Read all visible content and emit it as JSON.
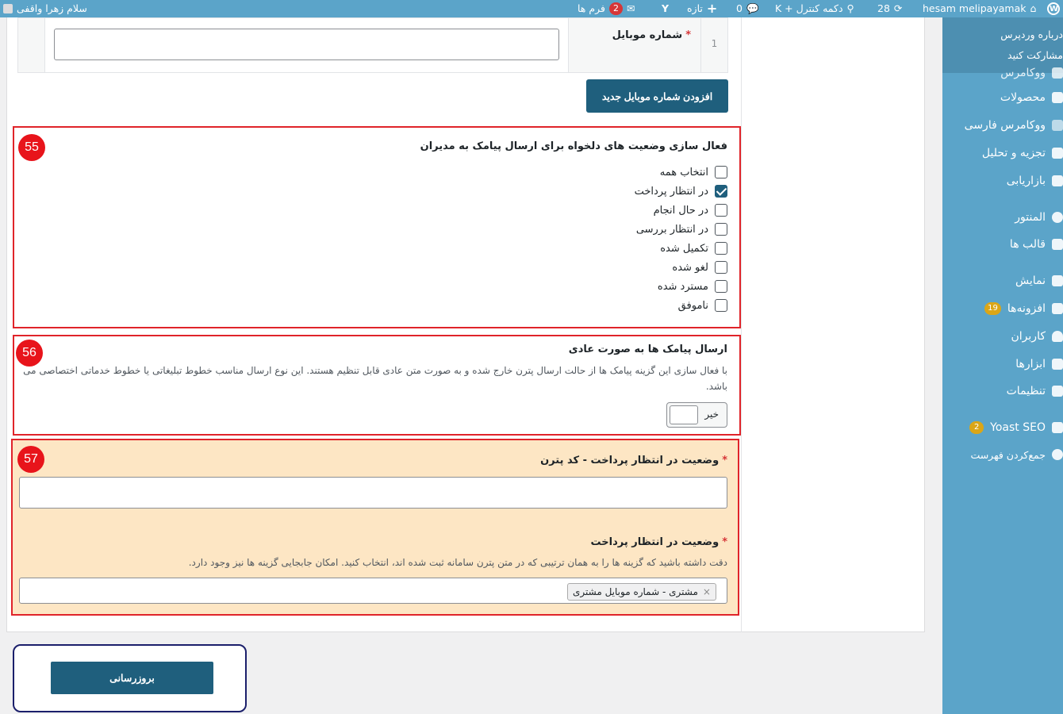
{
  "adminbar": {
    "greeting": "سلام زهرا واقفی",
    "forms_label": "فرم ها",
    "forms_count": "2",
    "new_label": "تازه",
    "comments_count": "0",
    "control_label": "K + دکمه کنترل",
    "updates_count": "28",
    "site_name": "hesam melipayamak"
  },
  "sidebar": {
    "flyout": [
      "درباره وردپرس",
      "مشارکت کنید"
    ],
    "partial_item": "ووکامرس",
    "items": [
      {
        "label": "محصولات",
        "badge": ""
      },
      {
        "label": "ووکامرس فارسی",
        "badge": ""
      },
      {
        "label": "تجزیه و تحلیل",
        "badge": ""
      },
      {
        "label": "بازاریابی",
        "badge": ""
      },
      {
        "label": "المنتور",
        "badge": ""
      },
      {
        "label": "قالب ها",
        "badge": ""
      },
      {
        "label": "نمایش",
        "badge": ""
      },
      {
        "label": "افزونه‌ها",
        "badge": "19"
      },
      {
        "label": "کاربران",
        "badge": ""
      },
      {
        "label": "ابزارها",
        "badge": ""
      },
      {
        "label": "تنظیمات",
        "badge": ""
      },
      {
        "label": "Yoast SEO",
        "badge": "2"
      },
      {
        "label": "جمع‌کردن فهرست",
        "badge": ""
      }
    ]
  },
  "mobile_row": {
    "index": "1",
    "label": "شماره موبایل",
    "required": "*",
    "value": ""
  },
  "add_mobile_button": "افزودن شماره موبایل جدید",
  "section55": {
    "number": "55",
    "title": "فعال سازی وضعیت های دلخواه برای ارسال پیامک به مدیران",
    "options": [
      {
        "label": "انتخاب همه",
        "checked": false
      },
      {
        "label": "در انتظار پرداخت",
        "checked": true
      },
      {
        "label": "در حال انجام",
        "checked": false
      },
      {
        "label": "در انتظار بررسی",
        "checked": false
      },
      {
        "label": "تکمیل شده",
        "checked": false
      },
      {
        "label": "لغو شده",
        "checked": false
      },
      {
        "label": "مسترد شده",
        "checked": false
      },
      {
        "label": "ناموفق",
        "checked": false
      }
    ]
  },
  "section56": {
    "number": "56",
    "title": "ارسال پیامک ها به صورت عادی",
    "desc": "با فعال سازی این گزینه پیامک ها از حالت ارسال پترن خارج شده و به صورت متن عادی قابل تنظیم هستند. این نوع ارسال مناسب خطوط تبلیغاتی یا خطوط خدماتی اختصاصی می باشد.",
    "toggle_label": "خیر"
  },
  "section57": {
    "number": "57",
    "field1_label": "وضعیت در انتظار پرداخت - کد پترن",
    "field1_value": "",
    "field2_label": "وضعیت در انتظار پرداخت",
    "field2_desc": "دقت داشته باشید که گزینه ها را به همان ترتیبی که در متن پترن سامانه ثبت شده اند، انتخاب کنید. امکان جابجایی گزینه ها نیز وجود دارد.",
    "token": "مشتری - شماره موبایل مشتری",
    "token_remove": "×",
    "required": "*"
  },
  "update_button": "بروزرسانی"
}
